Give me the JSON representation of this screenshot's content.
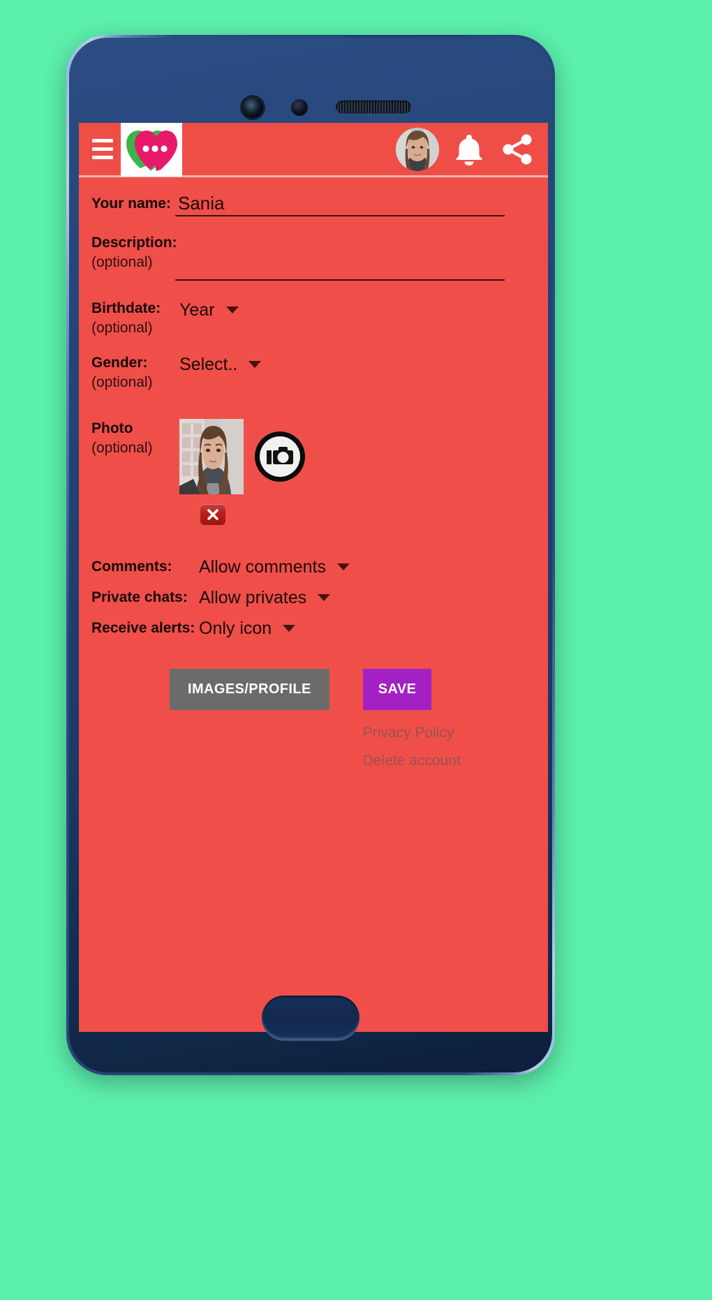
{
  "background_color": "#5cf0ad",
  "app": {
    "accent_color": "#ef4e47",
    "save_color": "#a321c4",
    "images_button_color": "#6b6b6b",
    "logo_green": "#3ab54a",
    "logo_pink": "#e8186a"
  },
  "appbar": {
    "menu_icon": "hamburger-menu-icon",
    "logo_icon": "heart-chat-logo-icon",
    "avatar_icon": "user-avatar",
    "bell_icon": "bell-icon",
    "share_icon": "share-icon"
  },
  "form": {
    "name": {
      "label": "Your name:",
      "value": "Sania",
      "placeholder": ""
    },
    "description": {
      "label": "Description:",
      "optional": "(optional)",
      "value": "",
      "placeholder": ""
    },
    "birthdate": {
      "label": "Birthdate:",
      "optional": "(optional)",
      "value": "Year"
    },
    "gender": {
      "label": "Gender:",
      "optional": "(optional)",
      "value": "Select.."
    },
    "photo": {
      "label": "Photo",
      "optional": "(optional)",
      "camera_icon": "camera-icon",
      "delete_icon": "close-x-icon"
    }
  },
  "settings": [
    {
      "label": "Comments:",
      "value": "Allow comments"
    },
    {
      "label": "Private chats:",
      "value": "Allow privates"
    },
    {
      "label": "Receive alerts:",
      "value": "Only icon"
    }
  ],
  "actions": {
    "images_profile": "IMAGES/PROFILE",
    "save": "SAVE",
    "privacy_policy": "Privacy Policy",
    "delete_account": "Delete account"
  }
}
